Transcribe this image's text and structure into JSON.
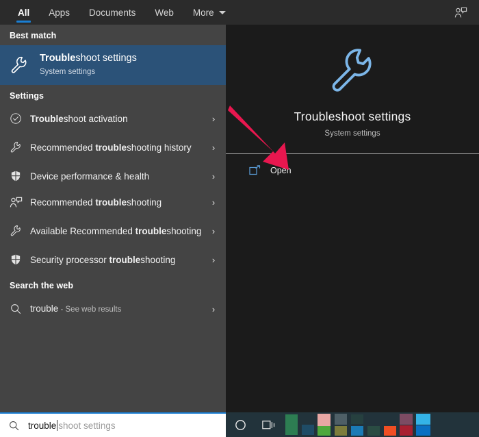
{
  "tabbar": {
    "tabs": [
      {
        "label": "All",
        "active": true
      },
      {
        "label": "Apps",
        "active": false
      },
      {
        "label": "Documents",
        "active": false
      },
      {
        "label": "Web",
        "active": false
      },
      {
        "label": "More",
        "active": false,
        "has_caret": true
      }
    ],
    "feedback_icon": "person-feedback-icon",
    "accent_color": "#1a7fd4",
    "background": "#2b2b2b"
  },
  "results": {
    "background": "#444444",
    "best_match": {
      "heading": "Best match",
      "icon": "wrench-icon",
      "title_bold": "Trouble",
      "title_rest": "shoot settings",
      "subtitle": "System settings",
      "highlight_color": "#2b5278"
    },
    "settings": {
      "heading": "Settings",
      "items": [
        {
          "icon": "check-circle-icon",
          "prefix": "",
          "bold": "Trouble",
          "suffix": "shoot activation",
          "chevron": "›"
        },
        {
          "icon": "wrench-icon",
          "prefix": "Recommended ",
          "bold": "trouble",
          "suffix": "shooting history",
          "chevron": "›"
        },
        {
          "icon": "shield-icon",
          "prefix": "Device performance & health",
          "bold": "",
          "suffix": "",
          "chevron": "›"
        },
        {
          "icon": "person-feedback-icon",
          "prefix": "Recommended ",
          "bold": "trouble",
          "suffix": "shooting",
          "chevron": "›"
        },
        {
          "icon": "wrench-icon",
          "prefix": "Available Recommended ",
          "bold": "trouble",
          "suffix": "shooting",
          "chevron": "›"
        },
        {
          "icon": "shield-icon",
          "prefix": "Security processor ",
          "bold": "trouble",
          "suffix": "shooting",
          "chevron": "›"
        }
      ]
    },
    "web": {
      "heading": "Search the web",
      "icon": "search-icon",
      "query": "trouble",
      "suffix": " - See web results",
      "chevron": "›"
    }
  },
  "preview": {
    "background": "#1b1b1b",
    "icon": "wrench-icon",
    "icon_color": "#7cb6e8",
    "title": "Troubleshoot settings",
    "subtitle": "System settings",
    "action": {
      "icon": "open-external-icon",
      "icon_color": "#5a9bd5",
      "label": "Open"
    }
  },
  "annotation": {
    "type": "arrow",
    "color": "#e8174f",
    "points_to": "Open"
  },
  "taskbar": {
    "background": "#22333b",
    "search": {
      "icon": "search-icon",
      "typed_value": "trouble",
      "suggestion_value": "shoot settings",
      "border_color": "#1a7fd4"
    },
    "buttons": [
      {
        "name": "cortana-icon",
        "glyph": "circle"
      },
      {
        "name": "task-view-icon",
        "glyph": "taskview"
      }
    ],
    "app_colors": [
      "#2d7d52",
      "#2d7d52",
      "#1f4c66",
      "#e8a7a4",
      "#4fa83d",
      "#4e5f66",
      "#7d7d3c",
      "#26403f",
      "#1b7bb5",
      "#2a4c43",
      "#f04e23",
      "#7c4b63",
      "#a81f31",
      "#34b3e8",
      "#0a6fc2"
    ]
  }
}
